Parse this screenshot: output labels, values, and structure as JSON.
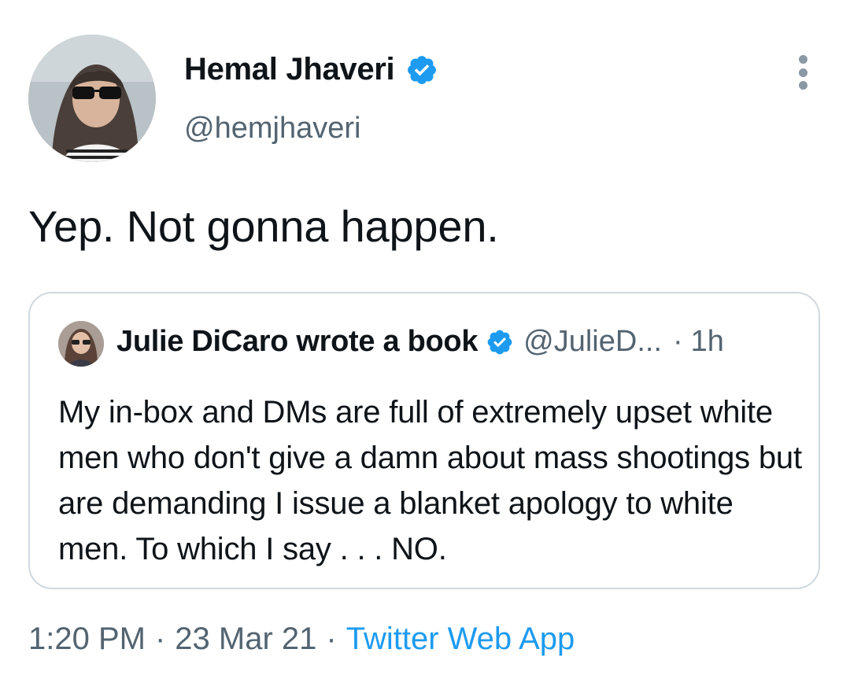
{
  "tweet": {
    "author": {
      "display_name": "Hemal Jhaveri",
      "handle": "@hemjhaveri",
      "verified_icon": "verified-badge-icon"
    },
    "more_icon": "more-vertical-icon",
    "text": "Yep. Not gonna happen.",
    "quoted_tweet": {
      "display_name": "Julie DiCaro wrote a book",
      "handle": "@JulieD...",
      "separator": "·",
      "time": "1h",
      "text": "My in-box and DMs are full of extremely upset white men who don't give a damn about mass shootings but are demanding I issue a blanket apology to white men. To which I say . . .  NO."
    },
    "meta": {
      "time": "1:20 PM",
      "sep1": "·",
      "date": "23 Mar 21",
      "sep2": "·",
      "source": "Twitter Web App"
    }
  },
  "colors": {
    "verified_blue": "#1d9bf0",
    "secondary_text": "#536471",
    "border": "#cfd9de"
  }
}
